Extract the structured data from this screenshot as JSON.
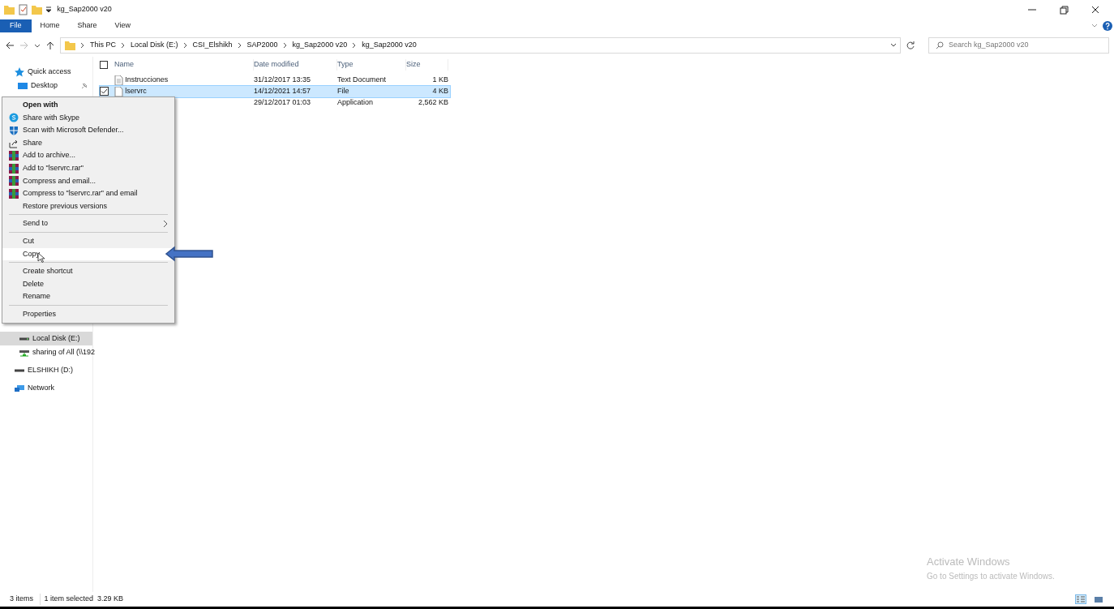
{
  "window": {
    "title": "kg_Sap2000 v20"
  },
  "ribbon": {
    "tabs": [
      {
        "label": "File",
        "selected": true
      },
      {
        "label": "Home",
        "selected": false
      },
      {
        "label": "Share",
        "selected": false
      },
      {
        "label": "View",
        "selected": false
      }
    ]
  },
  "address": {
    "crumbs": [
      "This PC",
      "Local Disk (E:)",
      "CSI_Elshikh",
      "SAP2000",
      "kg_Sap2000 v20",
      "kg_Sap2000 v20"
    ]
  },
  "search": {
    "placeholder": "Search kg_Sap2000 v20"
  },
  "sidebar": {
    "top": [
      {
        "label": "Quick access",
        "kind": "quick",
        "selected": false
      },
      {
        "label": "Desktop",
        "kind": "desktop",
        "selected": false,
        "pinned": true
      }
    ],
    "bottom": [
      {
        "label": "Local Disk (E:)",
        "kind": "drive",
        "selected": true
      },
      {
        "label": "sharing of All (\\\\192",
        "kind": "netdrive",
        "selected": false
      },
      {
        "label": "ELSHIKH (D:)",
        "kind": "removable",
        "selected": false
      },
      {
        "label": "Network",
        "kind": "network",
        "selected": false
      }
    ]
  },
  "table": {
    "select_all": {
      "checked": false
    },
    "columns": [
      "Name",
      "Date modified",
      "Type",
      "Size"
    ],
    "rows": [
      {
        "name": "Instrucciones",
        "kind": "text",
        "date": "31/12/2017 13:35",
        "type": "Text Document",
        "size": "1 KB",
        "selected": false,
        "checked": false
      },
      {
        "name": "lservrc",
        "kind": "file",
        "date": "14/12/2021 14:57",
        "type": "File",
        "size": "4 KB",
        "selected": true,
        "checked": true
      },
      {
        "kind": "hidden",
        "date": "29/12/2017 01:03",
        "type": "Application",
        "size": "2,562 KB",
        "selected": false,
        "checked": false
      }
    ]
  },
  "context_menu": {
    "items": [
      {
        "kind": "header",
        "label": "Open with",
        "selected": false
      },
      {
        "kind": "skype",
        "label": "Share with Skype",
        "selected": false
      },
      {
        "kind": "defender",
        "label": "Scan with Microsoft Defender...",
        "selected": false
      },
      {
        "kind": "share",
        "label": "Share",
        "selected": false
      },
      {
        "kind": "archive",
        "label": "Add to archive...",
        "selected": false
      },
      {
        "kind": "archive",
        "label": "Add to \"lservrc.rar\"",
        "selected": false
      },
      {
        "kind": "archive",
        "label": "Compress and email...",
        "selected": false
      },
      {
        "kind": "archive",
        "label": "Compress to \"lservrc.rar\" and email",
        "selected": false
      },
      {
        "kind": "plain",
        "label": "Restore previous versions",
        "selected": false
      },
      {
        "kind": "separator"
      },
      {
        "kind": "submenu",
        "label": "Send to",
        "selected": false
      },
      {
        "kind": "separator"
      },
      {
        "kind": "plain",
        "label": "Cut",
        "selected": false
      },
      {
        "kind": "plain",
        "label": "Copy",
        "selected": true
      },
      {
        "kind": "separator"
      },
      {
        "kind": "plain",
        "label": "Create shortcut",
        "selected": false
      },
      {
        "kind": "plain",
        "label": "Delete",
        "selected": false
      },
      {
        "kind": "plain",
        "label": "Rename",
        "selected": false
      },
      {
        "kind": "separator"
      },
      {
        "kind": "plain",
        "label": "Properties",
        "selected": false
      }
    ]
  },
  "status_bar": {
    "count": "3 items",
    "selection": "1 item selected  3.29 KB",
    "views": [
      {
        "kind": "details",
        "selected": true
      },
      {
        "kind": "thumbnails",
        "selected": false
      }
    ]
  },
  "activation_notice": {
    "title": "Activate Windows",
    "text": "Go to Settings to activate Windows."
  }
}
